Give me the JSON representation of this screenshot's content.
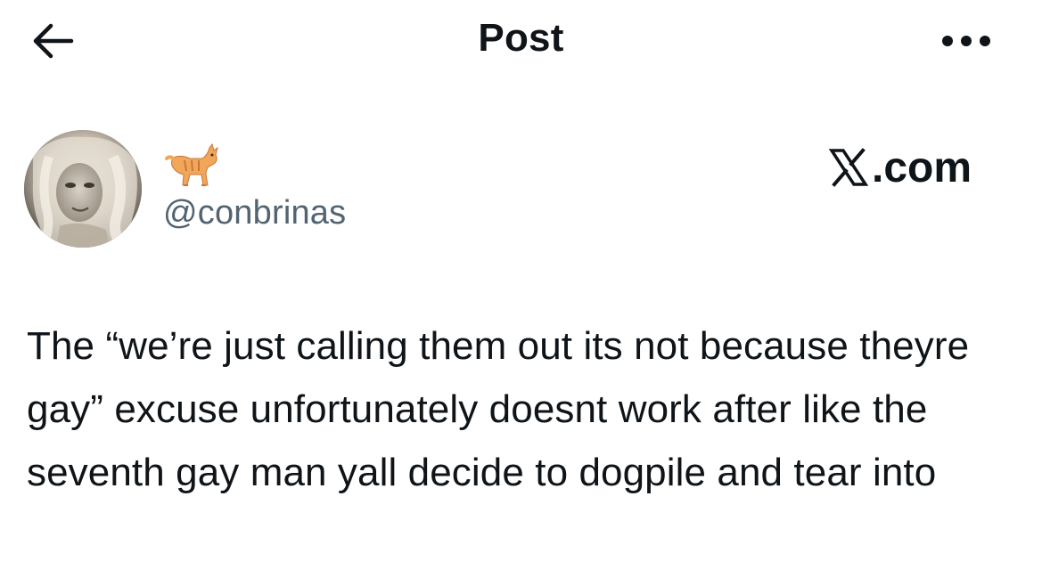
{
  "header": {
    "title": "Post",
    "back_icon": "arrow-left-icon",
    "more_icon": "more-horizontal-icon"
  },
  "author": {
    "display_name_emoji": "cat-emoji",
    "handle": "@conbrinas",
    "avatar": "avatar-photo"
  },
  "watermark": {
    "text": ".com",
    "logo": "x-logo-icon"
  },
  "post": {
    "text": "The “we’re just calling them out its not because theyre gay” excuse unfortunately doesnt work after like the seventh gay man yall decide to dogpile and tear into"
  },
  "colors": {
    "text_primary": "#0f1419",
    "text_secondary": "#536471",
    "background": "#ffffff"
  }
}
